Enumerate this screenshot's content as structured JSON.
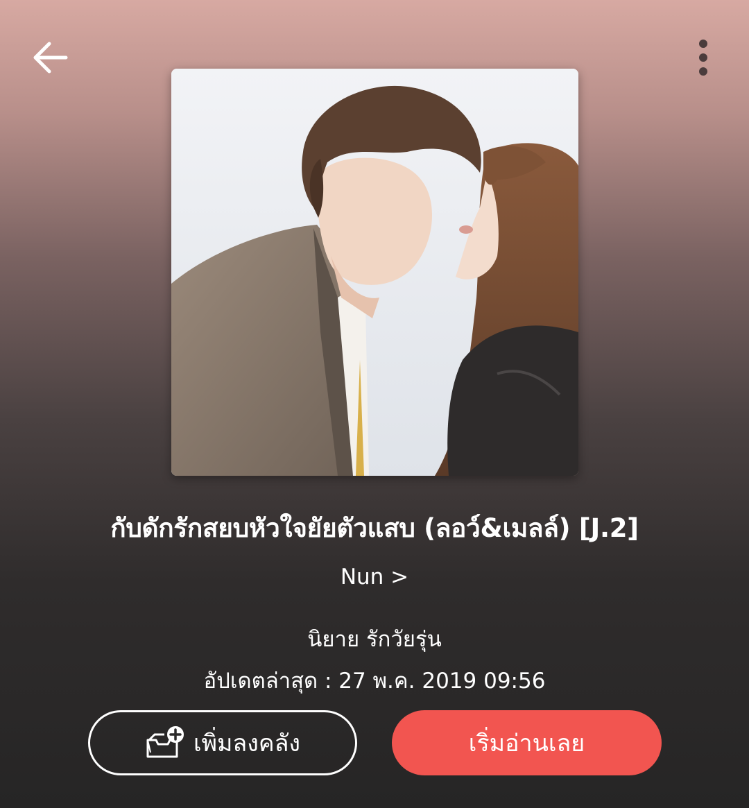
{
  "header": {
    "back_icon": "arrow-left-icon",
    "more_icon": "more-vertical-icon"
  },
  "book": {
    "title": "กับดักรักสยบหัวใจยัยตัวแสบ (ลอว์&เมลล์) [J.2]",
    "author": "Nun >",
    "category": "นิยาย รักวัยรุ่น",
    "updated": "อัปเดตล่าสุด : 27 พ.ค. 2019 09:56"
  },
  "actions": {
    "add_to_library_label": "เพิ่มลงคลัง",
    "add_to_library_icon": "library-add-icon",
    "read_now_label": "เริ่มอ่านเลย"
  },
  "colors": {
    "accent": "#f25550",
    "text": "#ffffff"
  }
}
